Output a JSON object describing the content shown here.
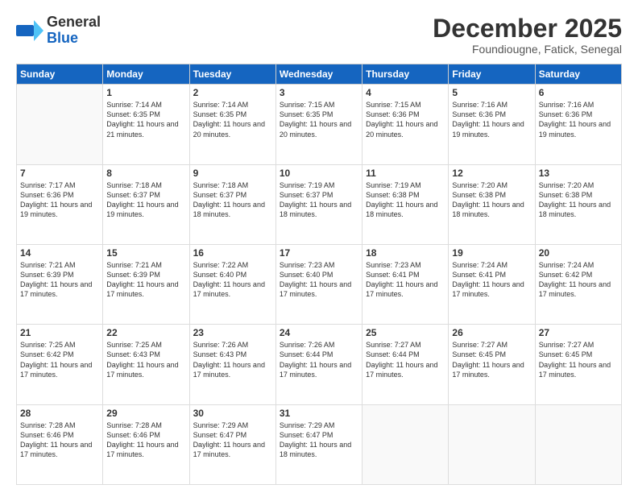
{
  "header": {
    "logo_general": "General",
    "logo_blue": "Blue",
    "month_title": "December 2025",
    "location": "Foundiougne, Fatick, Senegal"
  },
  "days_of_week": [
    "Sunday",
    "Monday",
    "Tuesday",
    "Wednesday",
    "Thursday",
    "Friday",
    "Saturday"
  ],
  "weeks": [
    [
      {
        "day": "",
        "info": ""
      },
      {
        "day": "1",
        "info": "Sunrise: 7:14 AM\nSunset: 6:35 PM\nDaylight: 11 hours\nand 21 minutes."
      },
      {
        "day": "2",
        "info": "Sunrise: 7:14 AM\nSunset: 6:35 PM\nDaylight: 11 hours\nand 20 minutes."
      },
      {
        "day": "3",
        "info": "Sunrise: 7:15 AM\nSunset: 6:35 PM\nDaylight: 11 hours\nand 20 minutes."
      },
      {
        "day": "4",
        "info": "Sunrise: 7:15 AM\nSunset: 6:36 PM\nDaylight: 11 hours\nand 20 minutes."
      },
      {
        "day": "5",
        "info": "Sunrise: 7:16 AM\nSunset: 6:36 PM\nDaylight: 11 hours\nand 19 minutes."
      },
      {
        "day": "6",
        "info": "Sunrise: 7:16 AM\nSunset: 6:36 PM\nDaylight: 11 hours\nand 19 minutes."
      }
    ],
    [
      {
        "day": "7",
        "info": "Sunrise: 7:17 AM\nSunset: 6:36 PM\nDaylight: 11 hours\nand 19 minutes."
      },
      {
        "day": "8",
        "info": "Sunrise: 7:18 AM\nSunset: 6:37 PM\nDaylight: 11 hours\nand 19 minutes."
      },
      {
        "day": "9",
        "info": "Sunrise: 7:18 AM\nSunset: 6:37 PM\nDaylight: 11 hours\nand 18 minutes."
      },
      {
        "day": "10",
        "info": "Sunrise: 7:19 AM\nSunset: 6:37 PM\nDaylight: 11 hours\nand 18 minutes."
      },
      {
        "day": "11",
        "info": "Sunrise: 7:19 AM\nSunset: 6:38 PM\nDaylight: 11 hours\nand 18 minutes."
      },
      {
        "day": "12",
        "info": "Sunrise: 7:20 AM\nSunset: 6:38 PM\nDaylight: 11 hours\nand 18 minutes."
      },
      {
        "day": "13",
        "info": "Sunrise: 7:20 AM\nSunset: 6:38 PM\nDaylight: 11 hours\nand 18 minutes."
      }
    ],
    [
      {
        "day": "14",
        "info": "Sunrise: 7:21 AM\nSunset: 6:39 PM\nDaylight: 11 hours\nand 17 minutes."
      },
      {
        "day": "15",
        "info": "Sunrise: 7:21 AM\nSunset: 6:39 PM\nDaylight: 11 hours\nand 17 minutes."
      },
      {
        "day": "16",
        "info": "Sunrise: 7:22 AM\nSunset: 6:40 PM\nDaylight: 11 hours\nand 17 minutes."
      },
      {
        "day": "17",
        "info": "Sunrise: 7:23 AM\nSunset: 6:40 PM\nDaylight: 11 hours\nand 17 minutes."
      },
      {
        "day": "18",
        "info": "Sunrise: 7:23 AM\nSunset: 6:41 PM\nDaylight: 11 hours\nand 17 minutes."
      },
      {
        "day": "19",
        "info": "Sunrise: 7:24 AM\nSunset: 6:41 PM\nDaylight: 11 hours\nand 17 minutes."
      },
      {
        "day": "20",
        "info": "Sunrise: 7:24 AM\nSunset: 6:42 PM\nDaylight: 11 hours\nand 17 minutes."
      }
    ],
    [
      {
        "day": "21",
        "info": "Sunrise: 7:25 AM\nSunset: 6:42 PM\nDaylight: 11 hours\nand 17 minutes."
      },
      {
        "day": "22",
        "info": "Sunrise: 7:25 AM\nSunset: 6:43 PM\nDaylight: 11 hours\nand 17 minutes."
      },
      {
        "day": "23",
        "info": "Sunrise: 7:26 AM\nSunset: 6:43 PM\nDaylight: 11 hours\nand 17 minutes."
      },
      {
        "day": "24",
        "info": "Sunrise: 7:26 AM\nSunset: 6:44 PM\nDaylight: 11 hours\nand 17 minutes."
      },
      {
        "day": "25",
        "info": "Sunrise: 7:27 AM\nSunset: 6:44 PM\nDaylight: 11 hours\nand 17 minutes."
      },
      {
        "day": "26",
        "info": "Sunrise: 7:27 AM\nSunset: 6:45 PM\nDaylight: 11 hours\nand 17 minutes."
      },
      {
        "day": "27",
        "info": "Sunrise: 7:27 AM\nSunset: 6:45 PM\nDaylight: 11 hours\nand 17 minutes."
      }
    ],
    [
      {
        "day": "28",
        "info": "Sunrise: 7:28 AM\nSunset: 6:46 PM\nDaylight: 11 hours\nand 17 minutes."
      },
      {
        "day": "29",
        "info": "Sunrise: 7:28 AM\nSunset: 6:46 PM\nDaylight: 11 hours\nand 17 minutes."
      },
      {
        "day": "30",
        "info": "Sunrise: 7:29 AM\nSunset: 6:47 PM\nDaylight: 11 hours\nand 17 minutes."
      },
      {
        "day": "31",
        "info": "Sunrise: 7:29 AM\nSunset: 6:47 PM\nDaylight: 11 hours\nand 18 minutes."
      },
      {
        "day": "",
        "info": ""
      },
      {
        "day": "",
        "info": ""
      },
      {
        "day": "",
        "info": ""
      }
    ]
  ]
}
